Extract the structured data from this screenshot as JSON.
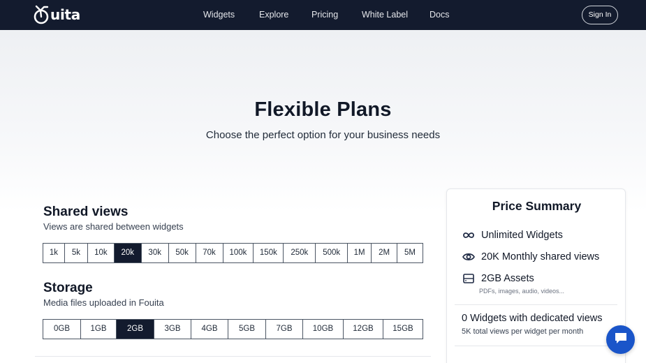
{
  "navbar": {
    "logo_text": "uita",
    "links": [
      "Widgets",
      "Explore",
      "Pricing",
      "White Label",
      "Docs"
    ],
    "signin_label": "Sign In"
  },
  "hero": {
    "title": "Flexible Plans",
    "subtitle": "Choose the perfect option for your business needs"
  },
  "views": {
    "title": "Shared views",
    "subtitle": "Views are shared between widgets",
    "options": [
      "1k",
      "5k",
      "10k",
      "20k",
      "30k",
      "50k",
      "70k",
      "100k",
      "150k",
      "250k",
      "500k",
      "1M",
      "2M",
      "5M"
    ],
    "selected": "20k"
  },
  "storage": {
    "title": "Storage",
    "subtitle": "Media files uploaded in Fouita",
    "options": [
      "0GB",
      "1GB",
      "2GB",
      "3GB",
      "4GB",
      "5GB",
      "7GB",
      "10GB",
      "12GB",
      "15GB"
    ],
    "selected": "2GB"
  },
  "summary": {
    "title": "Price Summary",
    "widgets": "Unlimited Widgets",
    "views": "20K Monthly shared views",
    "assets": "2GB Assets",
    "assets_note": "PDFs, images, audio, videos...",
    "dedicated": "0 Widgets with dedicated views",
    "dedicated_note": "5K total views per widget per month"
  },
  "colors": {
    "navbar": "#131b2e",
    "active": "#131b2e",
    "chat": "#1a55c9"
  },
  "icons": {
    "logo": "bicycle-logo-icon",
    "widgets": "infinity-icon",
    "views": "eye-icon",
    "assets": "storage-drive-icon",
    "chat": "chat-bubble-icon"
  }
}
